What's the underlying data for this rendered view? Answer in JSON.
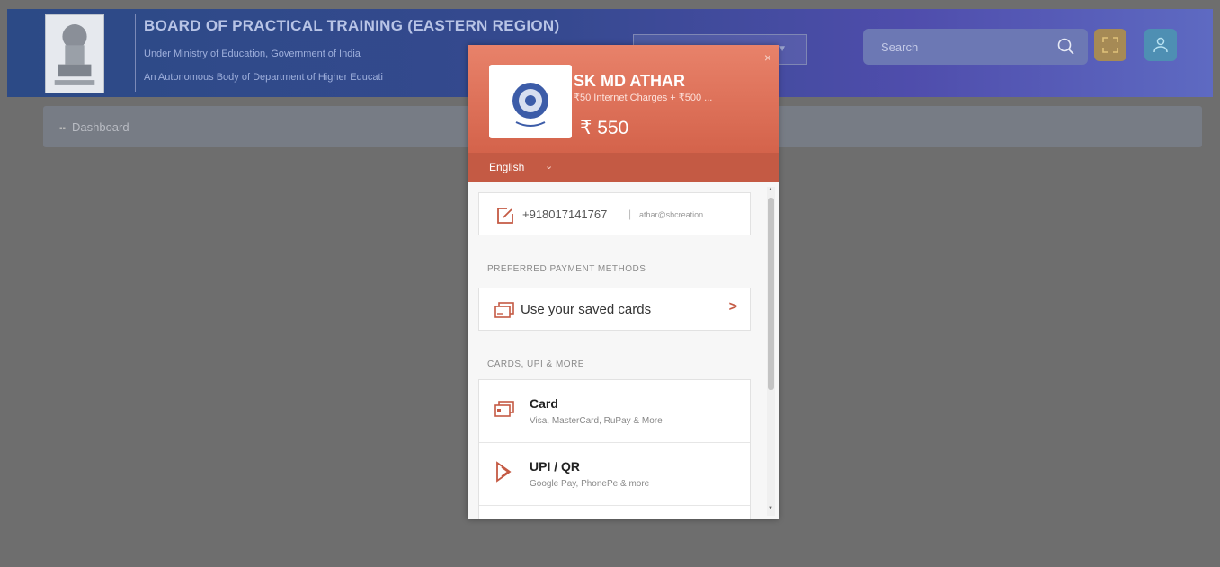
{
  "header": {
    "title": "BOARD OF PRACTICAL TRAINING (EASTERN REGION)",
    "subtitle1": "Under Ministry of Education, Government of India",
    "subtitle2": "An Autonomous Body of Department of Higher Educati",
    "search_placeholder": "Search",
    "emblem_icon": "india-emblem-icon",
    "fullscreen_icon": "fullscreen-icon",
    "user_icon": "user-icon"
  },
  "breadcrumb": {
    "icon": "dashboard-icon",
    "label": "Dashboard"
  },
  "payment": {
    "close": "×",
    "name": "SK MD ATHAR",
    "description": "₹50 Internet Charges + ₹500 ...",
    "amount": "₹ 550",
    "language": "English",
    "contact_phone": "+918017141767",
    "contact_separator": "|",
    "contact_email": "athar@sbcreation...",
    "section_preferred": "PREFERRED PAYMENT METHODS",
    "saved_cards_label": "Use your saved cards",
    "section_more": "CARDS, UPI & MORE",
    "methods": [
      {
        "title": "Card",
        "subtitle": "Visa, MasterCard, RuPay & More",
        "icon": "card-icon"
      },
      {
        "title": "UPI / QR",
        "subtitle": "Google Pay, PhonePe & more",
        "icon": "upi-icon"
      }
    ]
  },
  "colors": {
    "header_start": "#2c4a86",
    "header_end": "#5e6ac2",
    "modal_accent": "#d4634b",
    "overlay": "#6e6e6e"
  }
}
